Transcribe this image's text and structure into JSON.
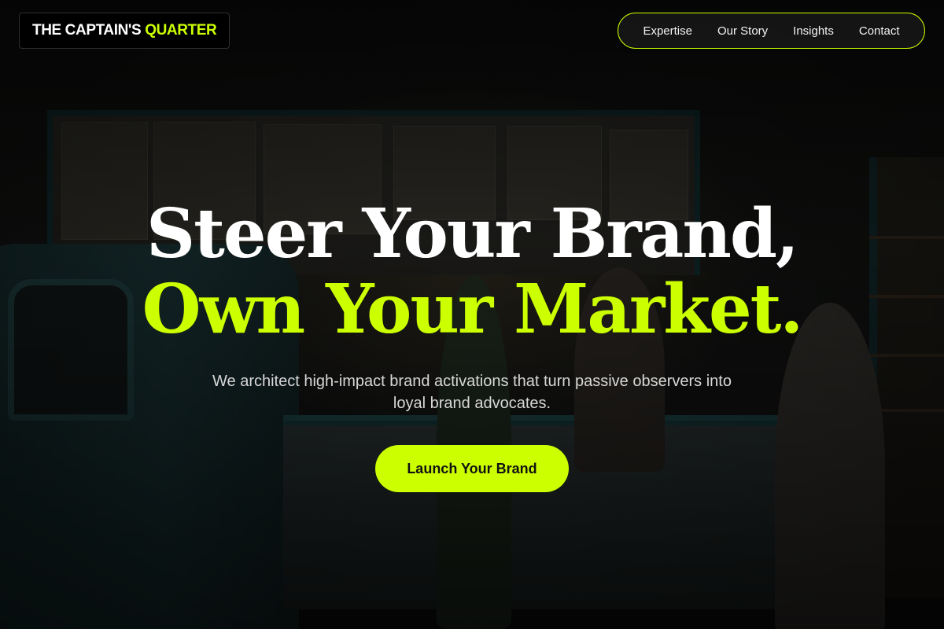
{
  "header": {
    "logo": {
      "main": "THE CAPTAIN'S",
      "accent": "QUARTER"
    },
    "nav": [
      {
        "label": "Expertise"
      },
      {
        "label": "Our Story"
      },
      {
        "label": "Insights"
      },
      {
        "label": "Contact"
      }
    ]
  },
  "hero": {
    "headline_line1": "Steer Your Brand,",
    "headline_line2": "Own Your Market.",
    "subcopy": "We architect high-impact brand activations that turn passive observers into loyal brand advocates.",
    "cta_label": "Launch Your Brand",
    "background_image": "darkened photo of a fish-and-chips shop interior with a teal food truck, counter and customers"
  },
  "colors": {
    "accent": "#ccff00",
    "background": "#0b0b0b",
    "text": "#ffffff"
  }
}
